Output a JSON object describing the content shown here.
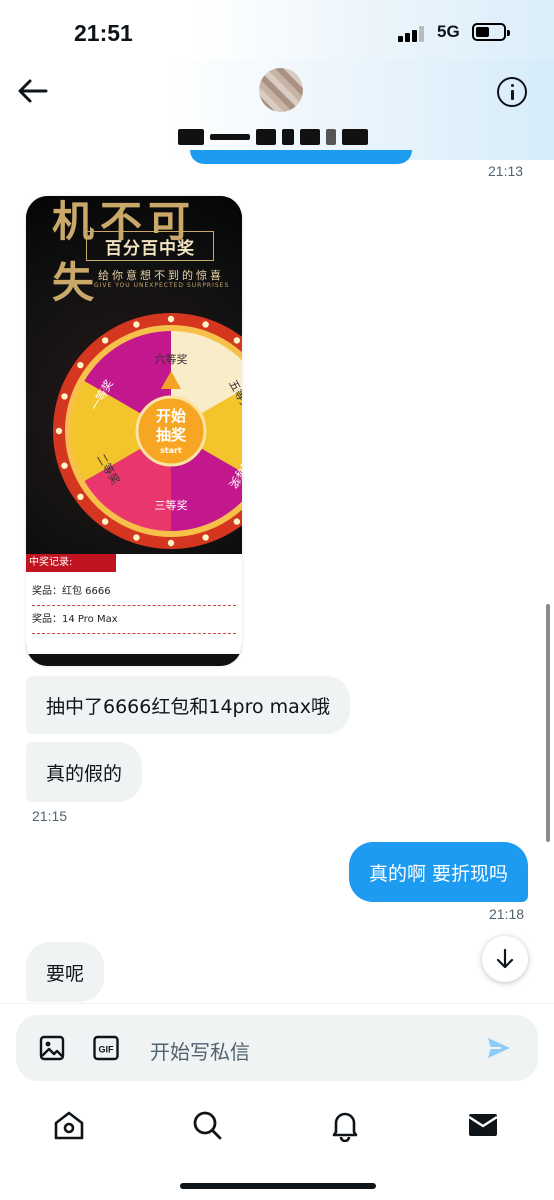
{
  "status_bar": {
    "time": "21:51",
    "network": "5G"
  },
  "header": {
    "contact_name": "(blurred name)"
  },
  "messages": {
    "prev_time": "21:13",
    "image_card": {
      "big_title": "机不可失",
      "subtitle": "百分百中奖",
      "tagline": "给你意想不到的惊喜",
      "tagline_en": "GIVE YOU UNEXPECTED SURPRISES",
      "wheel_center_1": "开始",
      "wheel_center_2": "抽奖",
      "wheel_center_3": "start",
      "wheel_prizes": [
        "六等奖",
        "五等奖",
        "四等奖",
        "三等奖",
        "二等奖",
        "一等奖"
      ],
      "records_title": "中奖记录:",
      "record_1": "奖品：红包 6666",
      "record_2": "奖品：14 Pro Max"
    },
    "msg1": "抽中了6666红包和14pro max哦",
    "msg2": "真的假的",
    "time2": "21:15",
    "msg3": "真的啊 要折现吗",
    "time3": "21:18",
    "msg4": "要呢"
  },
  "composer": {
    "placeholder": "开始写私信"
  },
  "colors": {
    "accent": "#1d9bf0",
    "bubble_in": "#eff3f4"
  },
  "icons": [
    "back-arrow-icon",
    "info-icon",
    "image-icon",
    "gif-icon",
    "send-icon",
    "arrow-down-icon",
    "home-icon",
    "search-icon",
    "bell-icon",
    "mail-icon"
  ]
}
